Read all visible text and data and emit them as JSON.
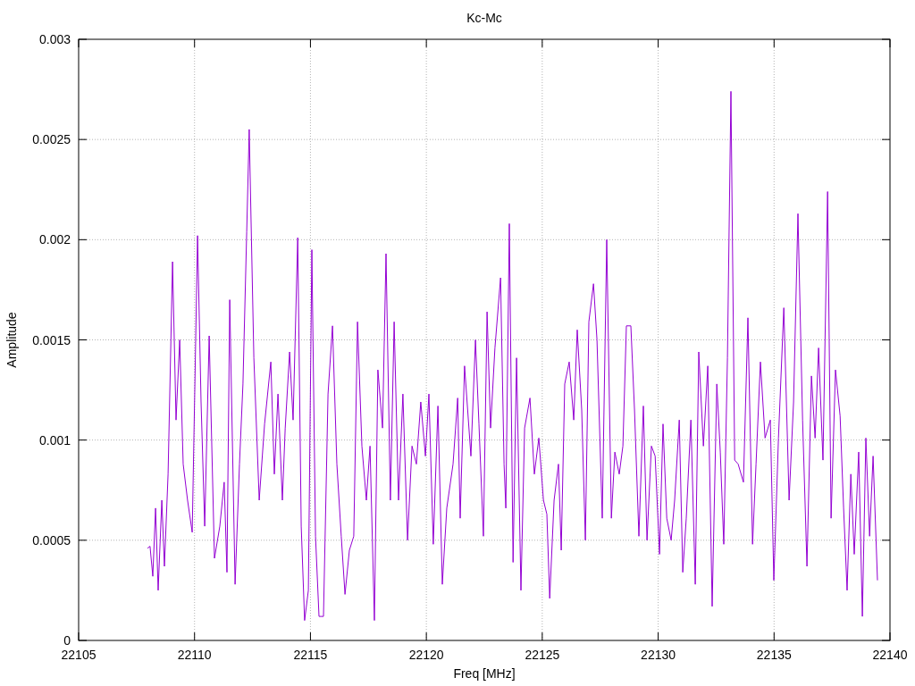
{
  "chart_data": {
    "type": "line",
    "grid": true,
    "title": "Kc-Mc",
    "xlabel": "Freq [MHz]",
    "ylabel": "Amplitude",
    "xlim": [
      22105,
      22140
    ],
    "ylim": [
      0,
      0.003
    ],
    "xticks": [
      {
        "value": 22105,
        "label": "22105"
      },
      {
        "value": 22110,
        "label": "22110"
      },
      {
        "value": 22115,
        "label": "22115"
      },
      {
        "value": 22120,
        "label": "22120"
      },
      {
        "value": 22125,
        "label": "22125"
      },
      {
        "value": 22130,
        "label": "22130"
      },
      {
        "value": 22135,
        "label": "22135"
      },
      {
        "value": 22140,
        "label": "22140"
      }
    ],
    "yticks": [
      {
        "value": 0,
        "label": "0"
      },
      {
        "value": 0.0005,
        "label": "0.0005"
      },
      {
        "value": 0.001,
        "label": "0.001"
      },
      {
        "value": 0.0015,
        "label": "0.0015"
      },
      {
        "value": 0.002,
        "label": "0.002"
      },
      {
        "value": 0.0025,
        "label": "0.0025"
      },
      {
        "value": 0.003,
        "label": "0.003"
      }
    ],
    "x": [
      22107.97,
      22108.08,
      22108.2,
      22108.32,
      22108.43,
      22108.59,
      22108.7,
      22108.86,
      22109.05,
      22109.2,
      22109.36,
      22109.51,
      22109.7,
      22109.9,
      22110.13,
      22110.28,
      22110.44,
      22110.63,
      22110.86,
      22111.09,
      22111.28,
      22111.4,
      22111.52,
      22111.75,
      22111.94,
      22112.09,
      22112.25,
      22112.36,
      22112.56,
      22112.79,
      22113.02,
      22113.29,
      22113.44,
      22113.6,
      22113.79,
      22113.91,
      22114.1,
      22114.25,
      22114.45,
      22114.6,
      22114.75,
      22114.91,
      22115.06,
      22115.22,
      22115.37,
      22115.56,
      22115.76,
      22115.95,
      22116.14,
      22116.33,
      22116.49,
      22116.68,
      22116.87,
      22117.03,
      22117.22,
      22117.41,
      22117.57,
      22117.76,
      22117.91,
      22118.11,
      22118.26,
      22118.45,
      22118.61,
      22118.8,
      22118.99,
      22119.19,
      22119.38,
      22119.57,
      22119.76,
      22119.96,
      22120.11,
      22120.3,
      22120.5,
      22120.69,
      22120.88,
      22121.15,
      22121.35,
      22121.46,
      22121.65,
      22121.92,
      22122.12,
      22122.27,
      22122.46,
      22122.62,
      22122.77,
      22122.96,
      22123.2,
      22123.35,
      22123.43,
      22123.58,
      22123.74,
      22123.89,
      22124.08,
      22124.24,
      22124.47,
      22124.66,
      22124.85,
      22125.05,
      22125.2,
      22125.32,
      22125.51,
      22125.7,
      22125.82,
      22125.97,
      22126.16,
      22126.36,
      22126.51,
      22126.7,
      22126.86,
      22127.01,
      22127.21,
      22127.36,
      22127.59,
      22127.78,
      22127.98,
      22128.13,
      22128.32,
      22128.48,
      22128.63,
      22128.82,
      22128.98,
      22129.17,
      22129.36,
      22129.52,
      22129.71,
      22129.87,
      22130.06,
      22130.21,
      22130.37,
      22130.56,
      22130.71,
      22130.91,
      22131.06,
      22131.21,
      22131.41,
      22131.6,
      22131.75,
      22131.95,
      22132.14,
      22132.33,
      22132.53,
      22132.68,
      22132.83,
      22132.99,
      22133.14,
      22133.3,
      22133.45,
      22133.68,
      22133.87,
      22134.07,
      22134.22,
      22134.41,
      22134.61,
      22134.84,
      22134.99,
      22135.19,
      22135.42,
      22135.65,
      22135.84,
      22136.03,
      22136.23,
      22136.42,
      22136.61,
      22136.77,
      22136.92,
      22137.11,
      22137.31,
      22137.46,
      22137.65,
      22137.85,
      22138.0,
      22138.15,
      22138.31,
      22138.46,
      22138.65,
      22138.81,
      22138.96,
      22139.12,
      22139.27,
      22139.46
    ],
    "series": [
      {
        "color": "#9400d3",
        "values": [
          0.00046,
          0.00047,
          0.00032,
          0.00066,
          0.00025,
          0.0007,
          0.00037,
          0.00083,
          0.00189,
          0.0011,
          0.0015,
          0.00088,
          0.0007,
          0.00054,
          0.00202,
          0.00119,
          0.00057,
          0.00152,
          0.00041,
          0.00057,
          0.00079,
          0.00034,
          0.0017,
          0.00028,
          0.00088,
          0.00128,
          0.00204,
          0.00255,
          0.00141,
          0.0007,
          0.00108,
          0.00139,
          0.00083,
          0.00123,
          0.0007,
          0.00106,
          0.00144,
          0.0011,
          0.00201,
          0.00057,
          0.0001,
          0.00025,
          0.00195,
          0.00052,
          0.00012,
          0.00012,
          0.00123,
          0.00157,
          0.00088,
          0.00052,
          0.00023,
          0.00045,
          0.00052,
          0.00159,
          0.00097,
          0.0007,
          0.00097,
          0.0001,
          0.00135,
          0.00106,
          0.00193,
          0.0007,
          0.00159,
          0.0007,
          0.00123,
          0.0005,
          0.00097,
          0.00088,
          0.00119,
          0.00092,
          0.00123,
          0.00048,
          0.00117,
          0.00028,
          0.00066,
          0.00088,
          0.00121,
          0.00061,
          0.00137,
          0.00092,
          0.0015,
          0.00108,
          0.00052,
          0.00164,
          0.00106,
          0.00146,
          0.00181,
          0.00088,
          0.00066,
          0.00208,
          0.00039,
          0.00141,
          0.00025,
          0.00106,
          0.00121,
          0.00083,
          0.00101,
          0.0007,
          0.00063,
          0.00021,
          0.0007,
          0.00088,
          0.00045,
          0.00128,
          0.00139,
          0.0011,
          0.00155,
          0.00115,
          0.0005,
          0.00159,
          0.00178,
          0.0015,
          0.00061,
          0.002,
          0.00061,
          0.00094,
          0.00083,
          0.00097,
          0.00157,
          0.00157,
          0.00115,
          0.00052,
          0.00117,
          0.0005,
          0.00097,
          0.00092,
          0.00043,
          0.00108,
          0.00061,
          0.0005,
          0.0007,
          0.0011,
          0.00034,
          0.00061,
          0.0011,
          0.00028,
          0.00144,
          0.00097,
          0.00137,
          0.00017,
          0.00128,
          0.00094,
          0.00048,
          0.00141,
          0.00274,
          0.0009,
          0.00088,
          0.00079,
          0.00161,
          0.00048,
          0.00088,
          0.00139,
          0.00101,
          0.0011,
          0.0003,
          0.00101,
          0.00166,
          0.0007,
          0.00119,
          0.00213,
          0.0011,
          0.00037,
          0.00132,
          0.00101,
          0.00146,
          0.0009,
          0.00224,
          0.00061,
          0.00135,
          0.00112,
          0.00066,
          0.00025,
          0.00083,
          0.00043,
          0.00094,
          0.00012,
          0.00101,
          0.00052,
          0.00092,
          0.0003
        ]
      }
    ]
  }
}
